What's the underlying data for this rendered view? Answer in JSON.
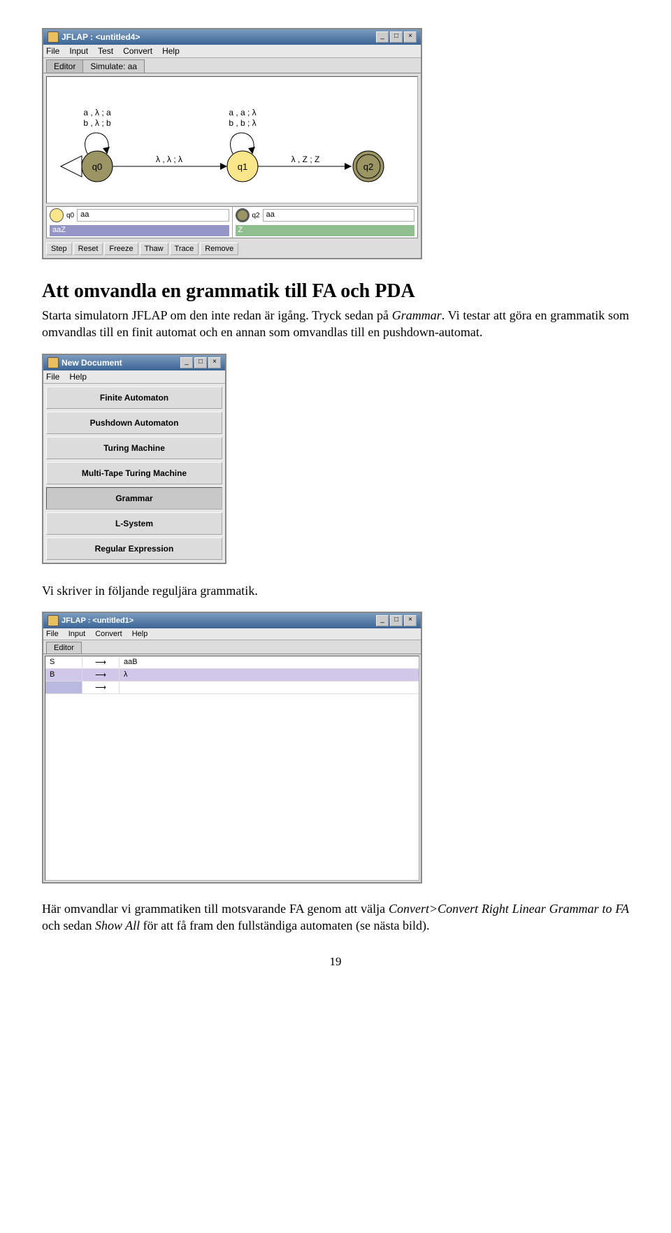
{
  "jflap1": {
    "title": "JFLAP : <untitled4>",
    "menus": [
      "File",
      "Input",
      "Test",
      "Convert",
      "Help"
    ],
    "tabs": [
      "Editor",
      "Simulate: aa"
    ],
    "states": {
      "q0": {
        "label": "q0",
        "loop": "a , λ ; a\nb , λ ; b",
        "color": "#9a9563"
      },
      "q1": {
        "label": "q1",
        "loop": "a , a ; λ\nb , b ; λ",
        "color": "#f9e68b"
      },
      "q2": {
        "label": "q2",
        "color": "#9a9563"
      }
    },
    "edges": {
      "e01": "λ , λ ; λ",
      "e12": "λ , Z ; Z"
    },
    "sim": {
      "left": {
        "state": "q0",
        "tape": "aa",
        "stack": "aaZ",
        "stateColor": "#f9e68b",
        "stackBg": "#9595c8"
      },
      "right": {
        "state": "q2",
        "tape": "aa",
        "stack": "Z",
        "stateColor": "#9a9563",
        "stackBg": "#8fbf8f"
      }
    },
    "buttons": [
      "Step",
      "Reset",
      "Freeze",
      "Thaw",
      "Trace",
      "Remove"
    ]
  },
  "section": {
    "heading": "Att omvandla en grammatik till FA och PDA",
    "para1_a": "Starta simulatorn JFLAP om den inte redan är igång. Tryck sedan på ",
    "para1_b": "Grammar",
    "para1_c": ". Vi testar att göra en grammatik som omvandlas till en finit automat och en annan som omvandlas till en pushdown-automat."
  },
  "newdoc": {
    "title": "New Document",
    "menus": [
      "File",
      "Help"
    ],
    "buttons": [
      {
        "label": "Finite Automaton",
        "selected": false
      },
      {
        "label": "Pushdown Automaton",
        "selected": false
      },
      {
        "label": "Turing Machine",
        "selected": false
      },
      {
        "label": "Multi-Tape Turing Machine",
        "selected": false
      },
      {
        "label": "Grammar",
        "selected": true
      },
      {
        "label": "L-System",
        "selected": false
      },
      {
        "label": "Regular Expression",
        "selected": false
      }
    ]
  },
  "para2": "Vi skriver in följande reguljära grammatik.",
  "grammar": {
    "title": "JFLAP : <untitled1>",
    "menus": [
      "File",
      "Input",
      "Convert",
      "Help"
    ],
    "tab": "Editor",
    "rows": [
      {
        "lhs": "S",
        "arrow": "⟶",
        "rhs": "aaB"
      },
      {
        "lhs": "B",
        "arrow": "⟶",
        "rhs": "λ"
      },
      {
        "lhs": "",
        "arrow": "⟶",
        "rhs": ""
      }
    ]
  },
  "para3_a": "Här omvandlar vi grammatiken till motsvarande FA genom att välja ",
  "para3_b": "Convert>Convert Right Linear Grammar to FA",
  "para3_c": " och sedan ",
  "para3_d": "Show All",
  "para3_e": " för att få fram den fullständiga automaten (se nästa bild).",
  "page": "19"
}
